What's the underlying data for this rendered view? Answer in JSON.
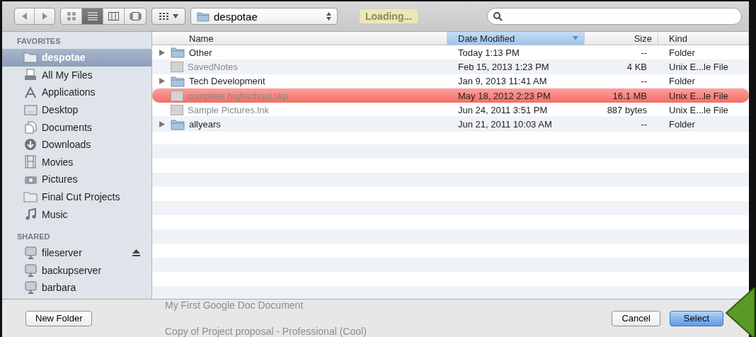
{
  "backdrop": {
    "badge": "Loading...",
    "rows": [
      {
        "name": "My First Google Doc Document"
      },
      {
        "name": "Copy of Project proposal - Professional (Cool)"
      }
    ]
  },
  "toolbar": {
    "views": [
      {
        "kind": "icons",
        "selected": false
      },
      {
        "kind": "list",
        "selected": true
      },
      {
        "kind": "columns",
        "selected": false
      },
      {
        "kind": "coverflow",
        "selected": false
      }
    ],
    "path": "despotae"
  },
  "sidebar": {
    "sections": [
      {
        "title": "FAVORITES",
        "items": [
          {
            "label": "despotae",
            "kind": "folder",
            "selected": true,
            "ejectable": false
          },
          {
            "label": "All My Files",
            "kind": "files",
            "selected": false,
            "ejectable": false
          },
          {
            "label": "Applications",
            "kind": "apps",
            "selected": false,
            "ejectable": false
          },
          {
            "label": "Desktop",
            "kind": "desktop",
            "selected": false,
            "ejectable": false
          },
          {
            "label": "Documents",
            "kind": "documents",
            "selected": false,
            "ejectable": false
          },
          {
            "label": "Downloads",
            "kind": "download",
            "selected": false,
            "ejectable": false
          },
          {
            "label": "Movies",
            "kind": "film",
            "selected": false,
            "ejectable": false
          },
          {
            "label": "Pictures",
            "kind": "camera",
            "selected": false,
            "ejectable": false
          },
          {
            "label": "Final Cut Projects",
            "kind": "folder",
            "selected": false,
            "ejectable": false
          },
          {
            "label": "Music",
            "kind": "music",
            "selected": false,
            "ejectable": false
          }
        ]
      },
      {
        "title": "SHARED",
        "items": [
          {
            "label": "fileserver",
            "kind": "computer",
            "selected": false,
            "ejectable": true
          },
          {
            "label": "backupserver",
            "kind": "computer",
            "selected": false,
            "ejectable": false
          },
          {
            "label": "barbara",
            "kind": "computer",
            "selected": false,
            "ejectable": false
          }
        ]
      }
    ]
  },
  "table": {
    "columns": [
      {
        "label": "Name",
        "selected": false
      },
      {
        "label": "Date Modified",
        "selected": true
      },
      {
        "label": "Size",
        "selected": false
      },
      {
        "label": "Kind",
        "selected": false
      }
    ],
    "rows": [
      {
        "kind": "folder",
        "name": "Other",
        "date": "Today 1:13 PM",
        "size": "--",
        "type": "Folder",
        "disabled": false,
        "selected": false
      },
      {
        "kind": "file",
        "name": "SavedNotes",
        "date": "Feb 15, 2013 1:23 PM",
        "size": "4 KB",
        "type": "Unix E...le File",
        "disabled": true,
        "selected": false
      },
      {
        "kind": "folder",
        "name": "Tech Development",
        "date": "Jan 9, 2013 11:41 AM",
        "size": "--",
        "type": "Folder",
        "disabled": false,
        "selected": false
      },
      {
        "kind": "file",
        "name": "complete highschool.skp",
        "date": "May 18, 2012 2:23 PM",
        "size": "16.1 MB",
        "type": "Unix E...le File",
        "disabled": true,
        "selected": true
      },
      {
        "kind": "file",
        "name": "Sample Pictures.lnk",
        "date": "Jun 24, 2011 3:51 PM",
        "size": "887 bytes",
        "type": "Unix E...le File",
        "disabled": true,
        "selected": false
      },
      {
        "kind": "folder",
        "name": "allyears",
        "date": "Jun 21, 2011 10:03 AM",
        "size": "--",
        "type": "Folder",
        "disabled": false,
        "selected": false
      }
    ]
  },
  "buttons": [
    {
      "label": "New Folder",
      "kind": "secondary"
    },
    {
      "label": "Cancel",
      "kind": "secondary"
    },
    {
      "label": "Select",
      "kind": "primary"
    }
  ]
}
